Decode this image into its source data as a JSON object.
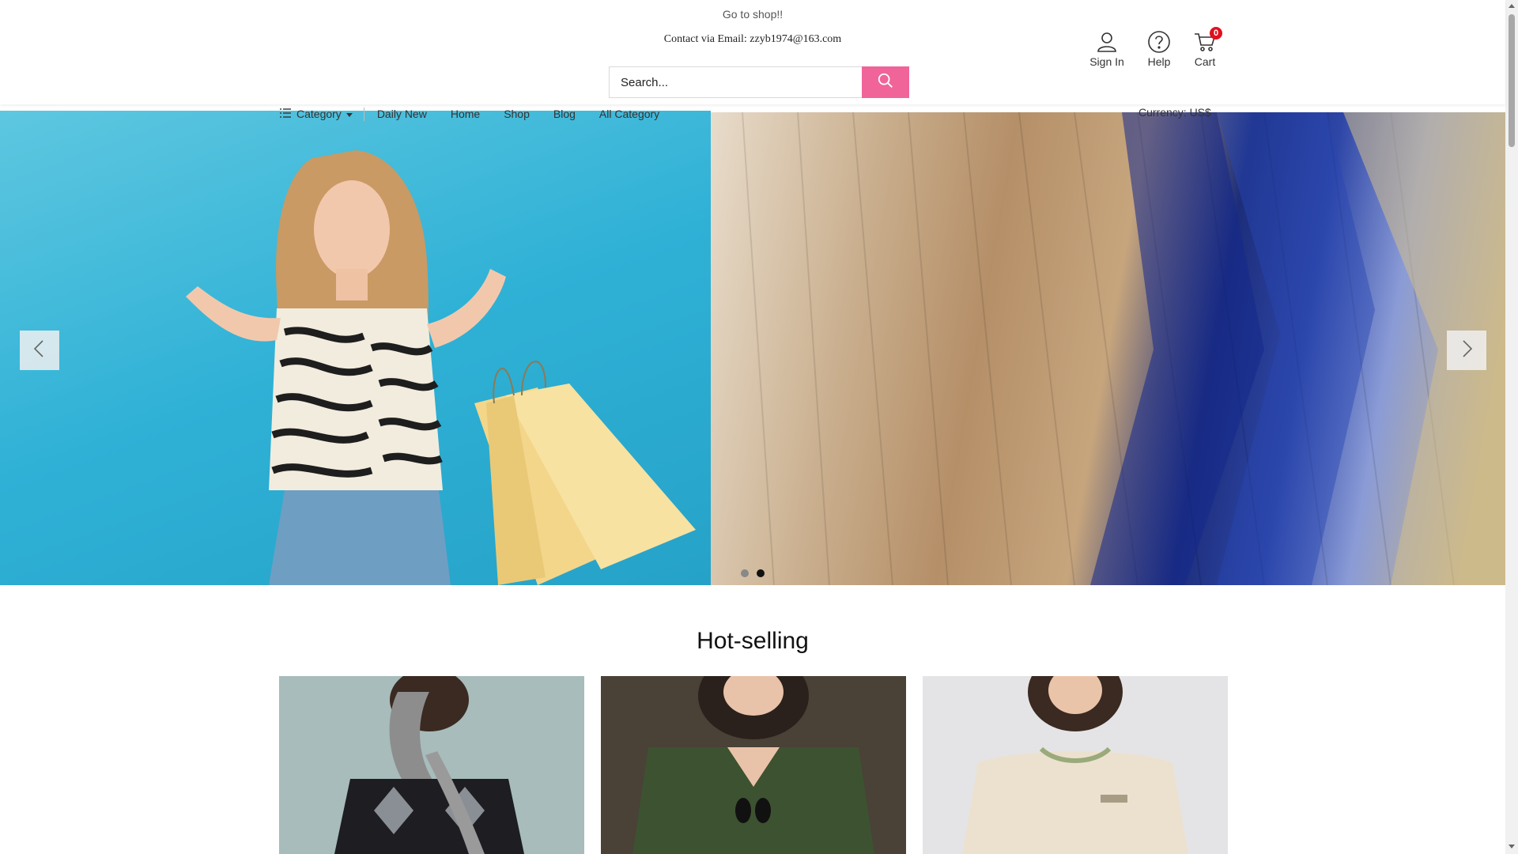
{
  "header": {
    "promo_text": "Go to shop!!",
    "contact_text": "Contact via Email: zzyb1974@163.com",
    "search_placeholder": "Search...",
    "sign_in_label": "Sign In",
    "help_label": "Help",
    "cart_label": "Cart",
    "cart_count": "0"
  },
  "nav": {
    "category_label": "Category",
    "items": [
      {
        "label": "Daily New"
      },
      {
        "label": "Home"
      },
      {
        "label": "Shop"
      },
      {
        "label": "Blog"
      },
      {
        "label": "All Category"
      }
    ],
    "currency_label": "Currency: US$"
  },
  "banner": {
    "slides_count": 2,
    "active_slide": 2
  },
  "hot_selling": {
    "title": "Hot-selling"
  },
  "colors": {
    "accent": "#f0649a",
    "badge": "#e0101f"
  }
}
